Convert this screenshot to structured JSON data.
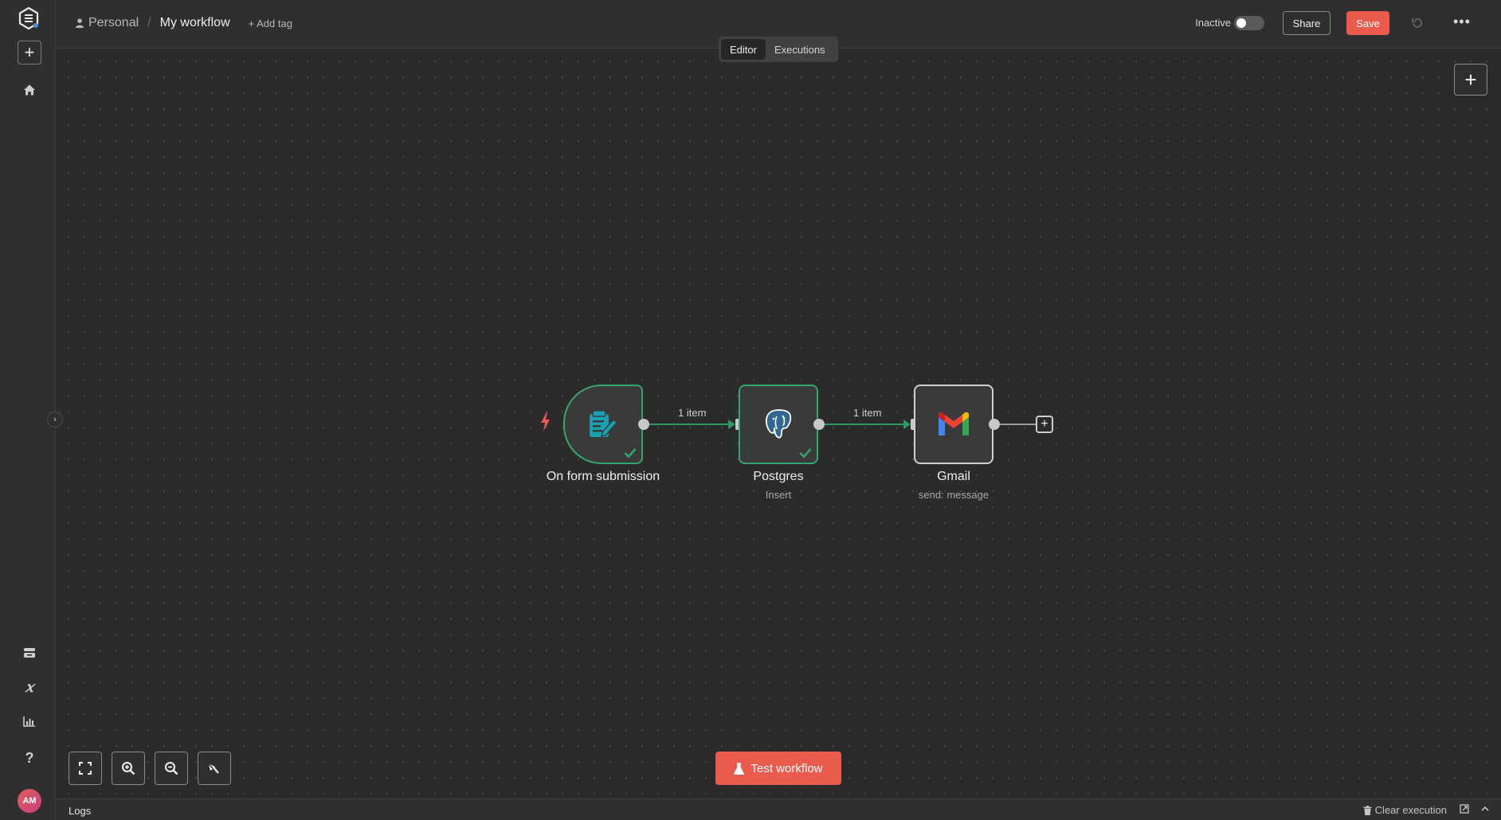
{
  "header": {
    "project": "Personal",
    "separator": "/",
    "workflow_name": "My workflow",
    "add_tag": "+ Add tag",
    "status_label": "Inactive",
    "share_label": "Share",
    "save_label": "Save",
    "more_label": "•••"
  },
  "mode_tabs": [
    {
      "label": "Editor",
      "active": true
    },
    {
      "label": "Executions",
      "active": false
    }
  ],
  "sidebar": {
    "avatar_initials": "AM",
    "items": [
      {
        "icon": "plus-icon",
        "label": "+"
      },
      {
        "icon": "home-icon"
      },
      {
        "icon": "templates-icon"
      },
      {
        "icon": "variables-icon",
        "label": "𝑥"
      },
      {
        "icon": "insights-icon"
      },
      {
        "icon": "help-icon",
        "label": "?"
      }
    ]
  },
  "canvas": {
    "add_node": "+",
    "nodes": [
      {
        "name": "On form submission",
        "subtitle": "",
        "status": "success",
        "type": "trigger",
        "icon": "form-icon"
      },
      {
        "name": "Postgres",
        "subtitle": "Insert",
        "status": "success",
        "type": "action",
        "icon": "postgres-icon"
      },
      {
        "name": "Gmail",
        "subtitle": "send: message",
        "status": "none",
        "type": "action",
        "icon": "gmail-icon"
      }
    ],
    "connections": [
      {
        "from": "On form submission",
        "to": "Postgres",
        "label": "1 item"
      },
      {
        "from": "Postgres",
        "to": "Gmail",
        "label": "1 item"
      }
    ],
    "end_plus": "+"
  },
  "controls": {
    "test_workflow": "Test workflow"
  },
  "logs": {
    "title": "Logs",
    "clear_execution": "Clear execution"
  },
  "colors": {
    "accent": "#ea5a4d",
    "success": "#35a66b",
    "background": "#2b2b2b"
  }
}
